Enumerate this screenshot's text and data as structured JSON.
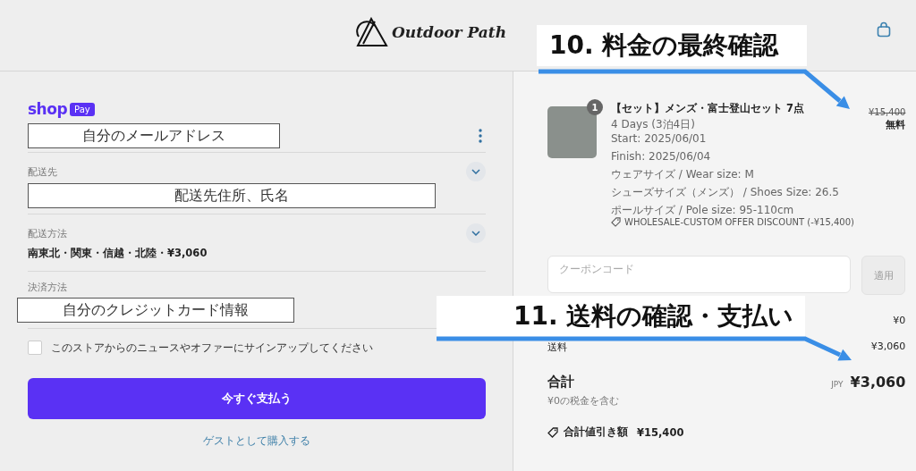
{
  "header": {
    "logo": "Outdoor Path"
  },
  "checkout": {
    "shop_pay": {
      "wordmark": "shop",
      "badge": "Pay"
    },
    "email": "自分のメールアドレス",
    "sections": [
      {
        "label": "配送先",
        "value": "配送先住所、氏名",
        "kind": "box",
        "expandable": true
      },
      {
        "label": "配送方法",
        "value": "南東北・関東・信越・北陸・¥3,060",
        "kind": "text",
        "expandable": true
      },
      {
        "label": "決済方法",
        "value": "自分のクレジットカード情報",
        "kind": "box",
        "expandable": false
      }
    ],
    "newsletter": {
      "label": "このストアからのニュースやオファーにサインアップしてください",
      "checked": false
    },
    "pay_button": "今すぐ支払う",
    "guest_link": "ゲストとして購入する"
  },
  "order": {
    "item": {
      "quantity": "1",
      "title": "【セット】メンズ・富士登山セット 7点",
      "details": [
        "4 Days (3泊4日)",
        "Start: 2025/06/01",
        "Finish: 2025/06/04",
        "ウェアサイズ / Wear size: M",
        "シューズサイズ（メンズ） / Shoes Size: 26.5",
        "ポールサイズ / Pole size: 95-110cm"
      ],
      "discount": "WHOLESALE-CUSTOM OFFER DISCOUNT (-¥15,400)",
      "original_price": "¥15,400",
      "price": "無料"
    },
    "coupon": {
      "placeholder": "クーポンコード",
      "button": "適用"
    },
    "subtotal_value": "¥0",
    "shipping": {
      "label": "送料",
      "value": "¥3,060"
    },
    "total": {
      "label": "合計",
      "currency": "JPY",
      "value": "¥3,060",
      "tax_note": "¥0の税金を含む"
    },
    "savings": {
      "label": "合計値引き額",
      "value": "¥15,400"
    }
  },
  "callouts": [
    {
      "text": "10. 料金の最終確認"
    },
    {
      "text": "11. 送料の確認・支払い"
    }
  ]
}
